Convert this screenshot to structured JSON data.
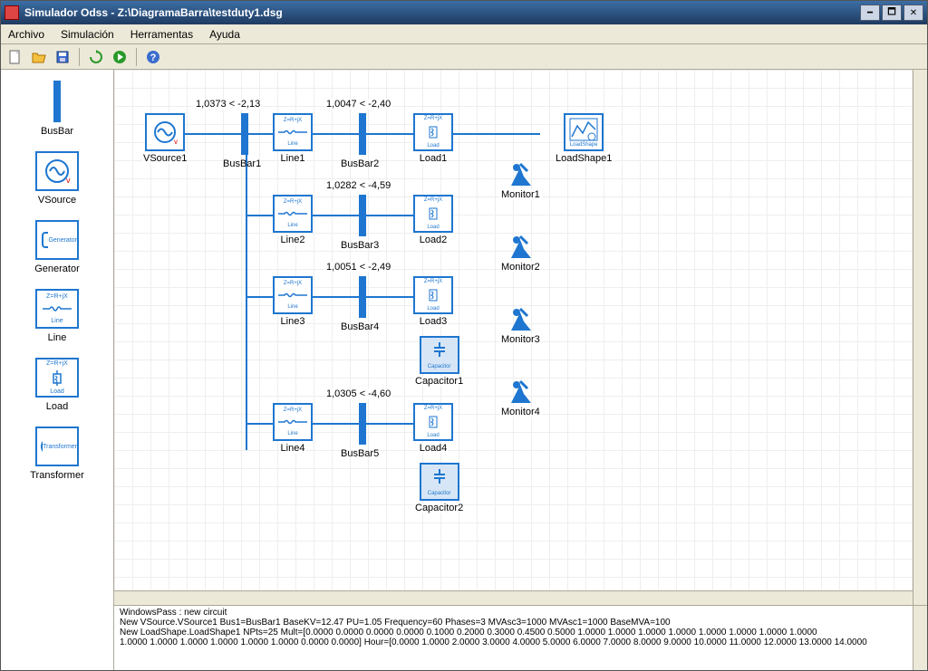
{
  "window": {
    "title": "Simulador Odss - Z:\\DiagramaBarra\\testduty1.dsg"
  },
  "menu": {
    "items": [
      "Archivo",
      "Simulación",
      "Herramentas",
      "Ayuda"
    ]
  },
  "toolbar": {
    "icons": [
      "new-file-icon",
      "open-folder-icon",
      "save-icon",
      "sep",
      "reload-icon",
      "run-icon",
      "sep",
      "help-icon"
    ]
  },
  "palette": {
    "items": [
      {
        "name": "busbar",
        "label": "BusBar",
        "icon": "busbar"
      },
      {
        "name": "vsource",
        "label": "VSource",
        "icon": "vsource"
      },
      {
        "name": "generator",
        "label": "Generator",
        "icon": "generator"
      },
      {
        "name": "line",
        "label": "Line",
        "icon": "line"
      },
      {
        "name": "load",
        "label": "Load",
        "icon": "load"
      },
      {
        "name": "transformer",
        "label": "Transformer",
        "icon": "transformer"
      }
    ]
  },
  "diagram": {
    "vsource": {
      "label": "VSource1"
    },
    "busbars": [
      {
        "name": "BusBar1",
        "label": "BusBar1",
        "top_value": "1,0373 < -2,13"
      },
      {
        "name": "BusBar2",
        "label": "BusBar2",
        "top_value": "1,0047 < -2,40"
      },
      {
        "name": "BusBar3",
        "label": "BusBar3",
        "top_value": "1,0282 < -4,59"
      },
      {
        "name": "BusBar4",
        "label": "BusBar4",
        "top_value": "1,0051 < -2,49"
      },
      {
        "name": "BusBar5",
        "label": "BusBar5",
        "top_value": "1,0305 < -4,60"
      }
    ],
    "lines": [
      {
        "label": "Line1"
      },
      {
        "label": "Line2"
      },
      {
        "label": "Line3"
      },
      {
        "label": "Line4"
      }
    ],
    "loads": [
      {
        "label": "Load1"
      },
      {
        "label": "Load2"
      },
      {
        "label": "Load3"
      },
      {
        "label": "Load4"
      }
    ],
    "capacitors": [
      {
        "label": "Capacitor1"
      },
      {
        "label": "Capacitor2"
      }
    ],
    "loadshape": {
      "label": "LoadShape1"
    },
    "monitors": [
      {
        "label": "Monitor1"
      },
      {
        "label": "Monitor2"
      },
      {
        "label": "Monitor3"
      },
      {
        "label": "Monitor4"
      }
    ],
    "icon_text": {
      "line_eq": "Z=R+jX",
      "line_sub": "Line",
      "load_sub": "Load",
      "cap_sub": "Capacitor",
      "gen_sub": "Generator",
      "xfmr_sub": "Transformer",
      "ls_sub": "LoadShape"
    }
  },
  "output": {
    "lines": [
      "WindowsPass : new circuit",
      "New VSource.VSource1 Bus1=BusBar1 BaseKV=12.47 PU=1.05 Frequency=60 Phases=3 MVAsc3=1000 MVAsc1=1000 BaseMVA=100",
      "New LoadShape.LoadShape1 NPts=25 Mult=[0.0000 0.0000 0.0000 0.0000 0.1000 0.2000 0.3000 0.4500 0.5000 1.0000 1.0000 1.0000 1.0000 1.0000 1.0000 1.0000 1.0000",
      "1.0000 1.0000 1.0000 1.0000 1.0000 1.0000 0.0000 0.0000] Hour=[0.0000 1.0000 2.0000 3.0000 4.0000 5.0000 6.0000 7.0000 8.0000 9.0000 10.0000 11.0000 12.0000 13.0000 14.0000"
    ]
  }
}
